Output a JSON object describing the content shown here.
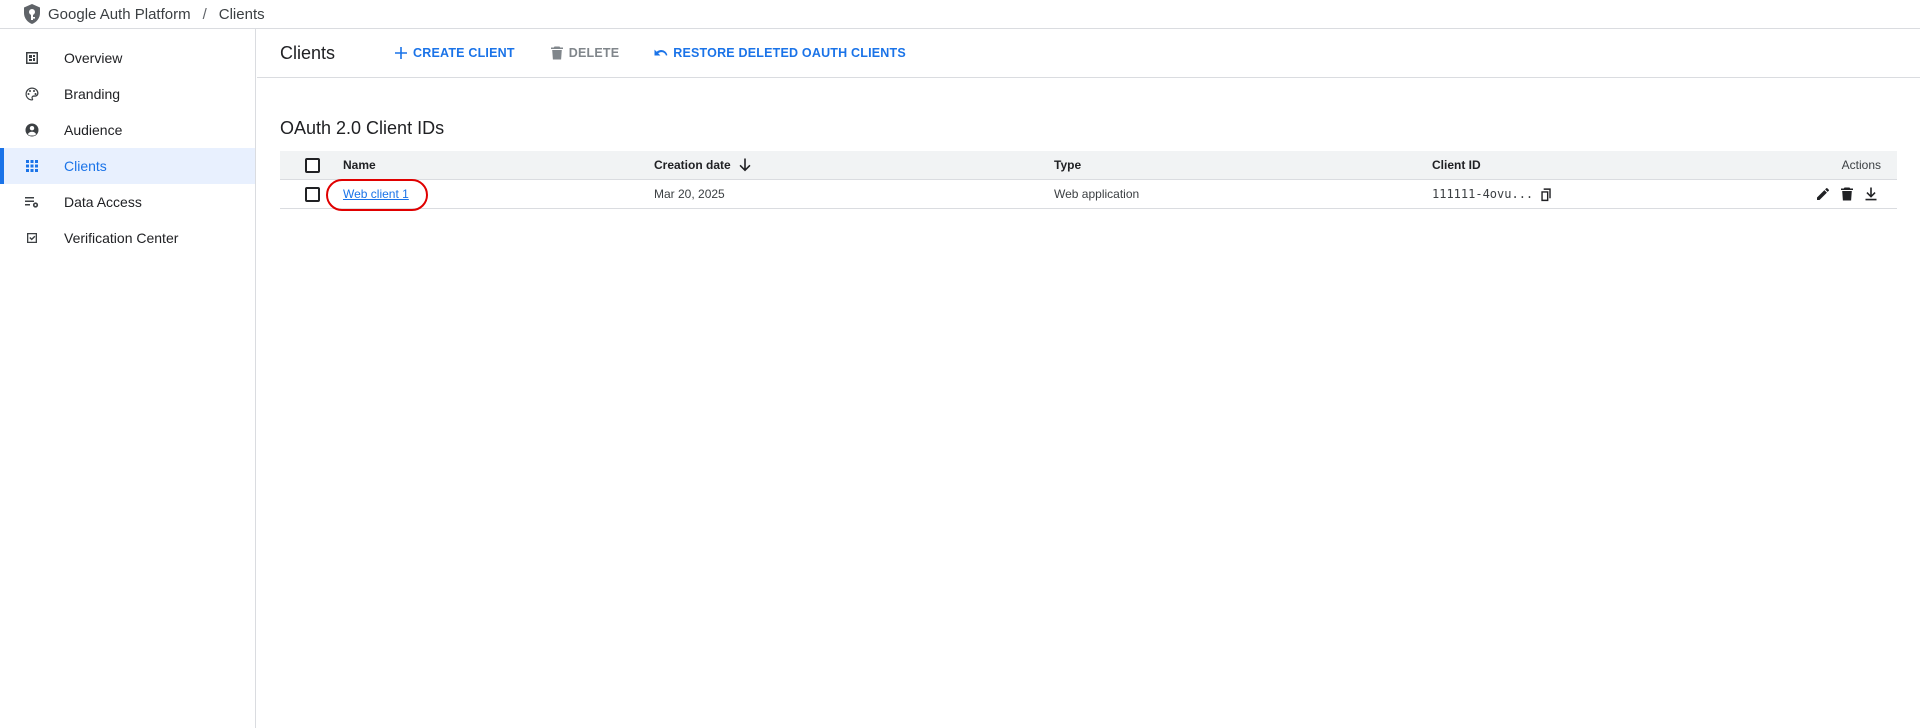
{
  "breadcrumb": {
    "app_name": "Google Auth Platform",
    "separator": "/",
    "current": "Clients",
    "logo_icon": "shield-key-icon"
  },
  "sidebar": {
    "active_color": "#1a73e8",
    "items": [
      {
        "label": "Overview",
        "icon": "dashboard-icon",
        "active": false
      },
      {
        "label": "Branding",
        "icon": "palette-icon",
        "active": false
      },
      {
        "label": "Audience",
        "icon": "account-circle-icon",
        "active": false
      },
      {
        "label": "Clients",
        "icon": "apps-grid-icon",
        "active": true
      },
      {
        "label": "Data Access",
        "icon": "data-settings-icon",
        "active": false
      },
      {
        "label": "Verification Center",
        "icon": "checkbox-icon",
        "active": false
      }
    ]
  },
  "header": {
    "title": "Clients",
    "create_label": "CREATE CLIENT",
    "delete_label": "DELETE",
    "restore_label": "RESTORE DELETED OAUTH CLIENTS"
  },
  "section": {
    "title": "OAuth 2.0 Client IDs"
  },
  "table": {
    "columns": {
      "name": "Name",
      "creation_date": "Creation date",
      "type": "Type",
      "client_id": "Client ID",
      "actions": "Actions"
    },
    "sort_icon": "arrow-down-icon",
    "rows": [
      {
        "name": "Web client 1",
        "creation_date": "Mar 20, 2025",
        "type": "Web application",
        "client_id": "111111-4ovu...",
        "highlighted": true,
        "highlight_color": "#e00000"
      }
    ]
  }
}
